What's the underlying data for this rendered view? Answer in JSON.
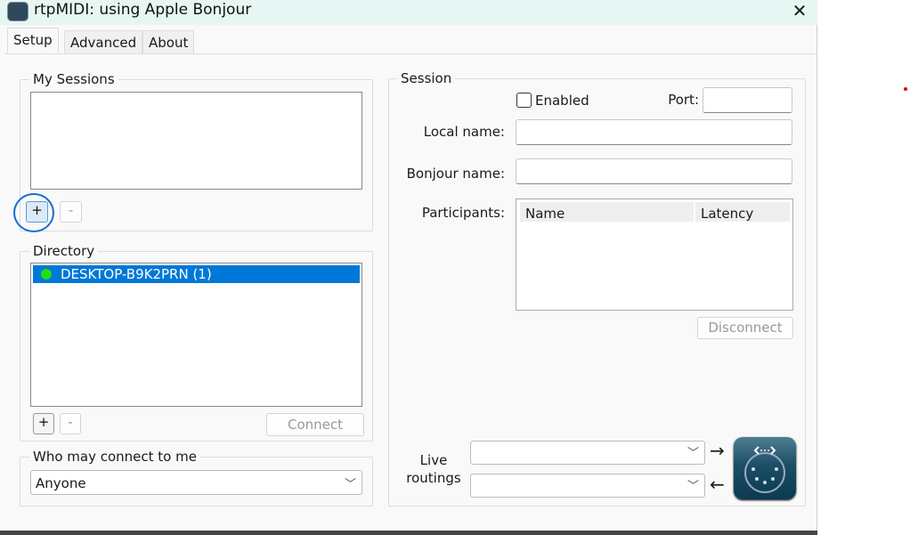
{
  "window": {
    "title": "rtpMIDI: using Apple Bonjour",
    "close": "✕"
  },
  "tabs": [
    "Setup",
    "Advanced",
    "About"
  ],
  "my_sessions": {
    "label": "My Sessions",
    "add": "+",
    "remove": "-"
  },
  "directory": {
    "label": "Directory",
    "items": [
      {
        "name": "DESKTOP-B9K2PRN (1)",
        "status_color": "#22dd11"
      }
    ],
    "add": "+",
    "remove": "-",
    "connect": "Connect"
  },
  "who": {
    "label": "Who may connect to me",
    "value": "Anyone"
  },
  "session": {
    "label": "Session",
    "enabled": "Enabled",
    "port": "Port:",
    "local_name": "Local name:",
    "bonjour_name": "Bonjour name:",
    "participants": "Participants:",
    "columns": [
      "Name",
      "Latency"
    ],
    "disconnect": "Disconnect"
  },
  "live": {
    "label": "Live routings",
    "out_arrow": "→",
    "in_arrow": "←"
  }
}
